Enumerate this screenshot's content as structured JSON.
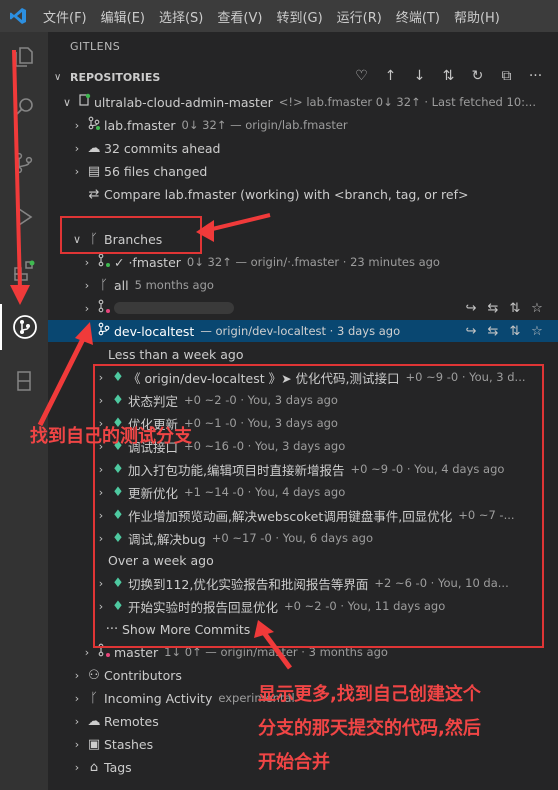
{
  "menu": [
    "文件(F)",
    "编辑(E)",
    "选择(S)",
    "查看(V)",
    "转到(G)",
    "运行(R)",
    "终端(T)",
    "帮助(H)"
  ],
  "panel_title": "GITLENS",
  "section_title": "REPOSITORIES",
  "repo": {
    "name": "ultralab-cloud-admin-master",
    "desc": "<!> lab.fmaster 0↓ 32↑ · Last fetched 10:..."
  },
  "repo_rows": [
    {
      "label": "lab.fmaster",
      "desc": "0↓ 32↑ — origin/lab.fmaster"
    },
    {
      "label": "32 commits ahead",
      "desc": ""
    },
    {
      "label": "56 files changed",
      "desc": ""
    },
    {
      "label": "Compare lab.fmaster (working) with <branch, tag, or ref>",
      "desc": ""
    }
  ],
  "branches_label": "Branches",
  "branch_rows": [
    {
      "label": "✓ ·fmaster",
      "desc": "0↓ 32↑ — origin/·.fmaster · 23 minutes ago"
    },
    {
      "label": "all",
      "desc": "5 months ago"
    }
  ],
  "selected_branch": {
    "label": "dev-localtest",
    "desc": "— origin/dev-localtest · 3 days ago"
  },
  "group1": "Less than a week ago",
  "commits_recent": [
    {
      "msg": "《 origin/dev-localtest 》➤  优化代码,测试接口",
      "desc": "+0 ~9 -0 · You, 3 d..."
    },
    {
      "msg": "状态判定",
      "desc": "+0 ~2 -0 · You, 3 days ago"
    },
    {
      "msg": "优化更新",
      "desc": "+0 ~1 -0 · You, 3 days ago"
    },
    {
      "msg": "调试接口",
      "desc": "+0 ~16 -0 · You, 3 days ago"
    },
    {
      "msg": "加入打包功能,编辑项目时直接新增报告",
      "desc": "+0 ~9 -0 · You, 4 days ago"
    },
    {
      "msg": "更新优化",
      "desc": "+1 ~14 -0 · You, 4 days ago"
    },
    {
      "msg": "作业增加预览动画,解决webscoket调用键盘事件,回显优化",
      "desc": "+0 ~7 -..."
    },
    {
      "msg": "调试,解决bug",
      "desc": "+0 ~17 -0 · You, 6 days ago"
    }
  ],
  "group2": "Over a week ago",
  "commits_old": [
    {
      "msg": "切换到112,优化实验报告和批阅报告等界面",
      "desc": "+2 ~6 -0 · You, 10 da..."
    },
    {
      "msg": "开始实验时的报告回显优化",
      "desc": "+0 ~2 -0 · You, 11 days ago"
    }
  ],
  "show_more": "Show More Commits",
  "master_row": {
    "label": "master",
    "desc": "1↓ 0↑ — origin/master · 3 months ago"
  },
  "bottom_rows": [
    {
      "label": "Contributors",
      "desc": ""
    },
    {
      "label": "Incoming Activity",
      "desc": "experimental"
    },
    {
      "label": "Remotes",
      "desc": ""
    },
    {
      "label": "Stashes",
      "desc": ""
    },
    {
      "label": "Tags",
      "desc": ""
    }
  ],
  "annotations": {
    "find_branch": "找到自己的测试分支",
    "show_more_note_1": "显示更多,找到自己创建这个",
    "show_more_note_2": "分支的那天提交的代码,然后",
    "show_more_note_3": "开始合并"
  }
}
